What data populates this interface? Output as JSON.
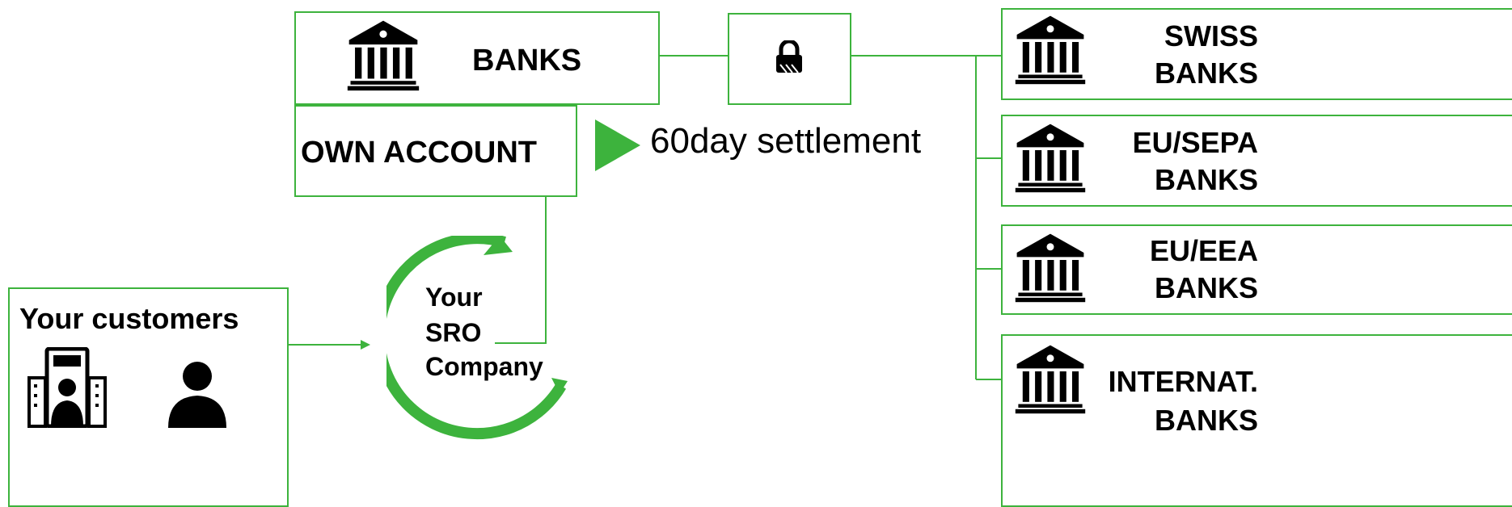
{
  "colors": {
    "accent": "#3db33d",
    "text": "#000000",
    "background": "#ffffff"
  },
  "banks": {
    "label": "BANKS",
    "icon": "bank-icon"
  },
  "lock": {
    "icon": "lock-icon"
  },
  "own_account": {
    "label": "OWN ACCOUNT"
  },
  "settlement": {
    "label": "60day settlement",
    "icon": "play-arrow-icon"
  },
  "company": {
    "line1": "Your",
    "line2": "SRO",
    "line3": "Company"
  },
  "customers": {
    "label": "Your customers",
    "icons": [
      "kiosk-terminal-icon",
      "person-icon"
    ]
  },
  "bank_groups": [
    {
      "line1": "SWISS",
      "line2": "BANKS"
    },
    {
      "line1": "EU/SEPA",
      "line2": "BANKS"
    },
    {
      "line1": "EU/EEA",
      "line2": "BANKS"
    },
    {
      "line1": "INTERNAT.",
      "line2": "BANKS"
    }
  ]
}
